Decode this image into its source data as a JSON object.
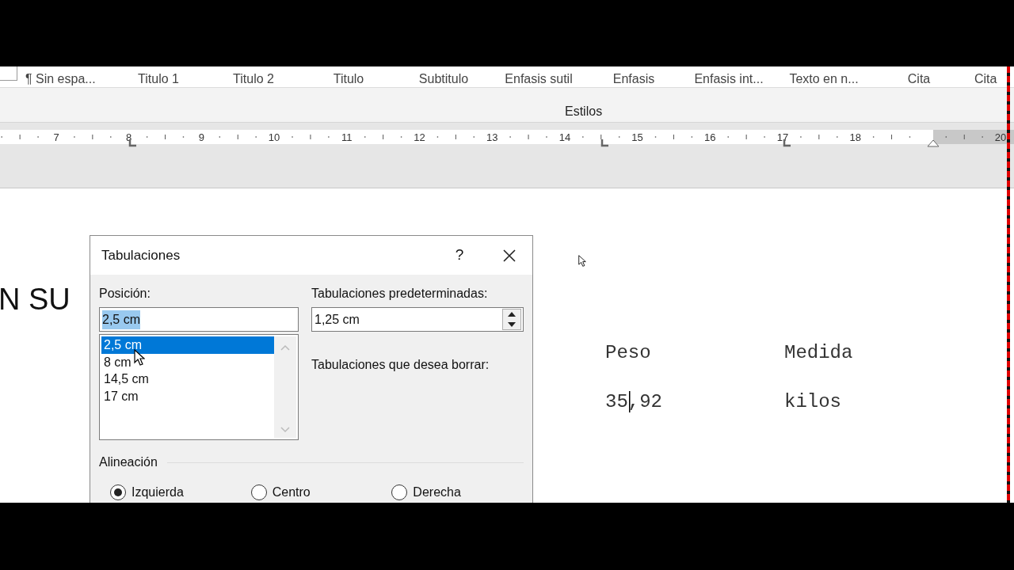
{
  "ribbon": {
    "styles": [
      {
        "label": "¶ Sin espa..."
      },
      {
        "label": "Titulo 1"
      },
      {
        "label": "Titulo 2"
      },
      {
        "label": "Titulo"
      },
      {
        "label": "Subtitulo"
      },
      {
        "label": "Enfasis sutil"
      },
      {
        "label": "Enfasis"
      },
      {
        "label": "Enfasis int..."
      },
      {
        "label": "Texto en n..."
      },
      {
        "label": "Cita"
      },
      {
        "label": "Cita"
      }
    ],
    "group_label": "Estilos"
  },
  "ruler": {
    "labels": [
      "7",
      "8",
      "9",
      "10",
      "11",
      "12",
      "13",
      "14",
      "15",
      "16",
      "17",
      "18"
    ],
    "end_label": "20"
  },
  "document": {
    "heading_fragment": "N SU",
    "columns": [
      {
        "header": "Peso",
        "value": "35,92",
        "caret": true
      },
      {
        "header": "Medida",
        "value": "kilos",
        "caret": false
      }
    ]
  },
  "dialog": {
    "title": "Tabulaciones",
    "help": "?",
    "position": {
      "label": "Posición:",
      "value": "2,5 cm",
      "value_selected": true
    },
    "tab_stops": [
      {
        "label": "2,5 cm",
        "selected": true
      },
      {
        "label": "8 cm",
        "selected": false
      },
      {
        "label": "14,5 cm",
        "selected": false
      },
      {
        "label": "17 cm",
        "selected": false
      }
    ],
    "default_tabs": {
      "label": "Tabulaciones predeterminadas:",
      "value": "1,25 cm"
    },
    "clear_label": "Tabulaciones que desea borrar:",
    "alignment": {
      "label": "Alineación",
      "options": [
        {
          "label": "Izquierda",
          "checked": true
        },
        {
          "label": "Centro",
          "checked": false
        },
        {
          "label": "Derecha",
          "checked": false
        }
      ]
    }
  }
}
